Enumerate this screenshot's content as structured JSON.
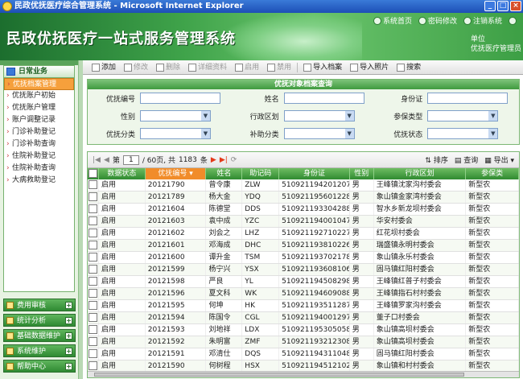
{
  "window": {
    "title": "民政优抚医疗综合管理系统 - Microsoft Internet Explorer"
  },
  "header": {
    "app_title": "民政优抚医疗一站式服务管理系统",
    "links": [
      {
        "label": "系统首页",
        "icon": "home-icon"
      },
      {
        "label": "密码修改",
        "icon": "key-icon"
      },
      {
        "label": "注销系统",
        "icon": "logout-icon"
      },
      {
        "label": "",
        "icon": "help-icon"
      }
    ],
    "user_line1": "单位",
    "user_line2": "优抚医疗管理员"
  },
  "sidebar": {
    "section_title": "日常业务",
    "items": [
      {
        "label": "优抚档案管理",
        "active": true
      },
      {
        "label": "优抚账户初始"
      },
      {
        "label": "优抚账户管理"
      },
      {
        "label": "账户调整记录"
      },
      {
        "label": "门诊补助登记"
      },
      {
        "label": "门诊补助查询"
      },
      {
        "label": "住院补助登记"
      },
      {
        "label": "住院补助查询"
      },
      {
        "label": "大病救助登记"
      }
    ],
    "groups": [
      {
        "label": "费用审核"
      },
      {
        "label": "统计分析"
      },
      {
        "label": "基础数据维护"
      },
      {
        "label": "系统维护"
      },
      {
        "label": "帮助中心"
      }
    ]
  },
  "toolbar": {
    "buttons": [
      {
        "label": "添加",
        "icon": "add-icon",
        "enabled": true
      },
      {
        "label": "修改",
        "icon": "edit-icon",
        "enabled": false
      },
      {
        "label": "删除",
        "icon": "delete-icon",
        "enabled": false
      },
      {
        "label": "详细资料",
        "icon": "details-icon",
        "enabled": false
      },
      {
        "label": "启用",
        "icon": "enable-icon",
        "enabled": false
      },
      {
        "label": "禁用",
        "icon": "disable-icon",
        "enabled": false
      },
      {
        "label": "导入档案",
        "icon": "import-icon",
        "enabled": true
      },
      {
        "label": "导入照片",
        "icon": "photo-icon",
        "enabled": true
      },
      {
        "label": "搜索",
        "icon": "search-icon",
        "enabled": true
      }
    ]
  },
  "search": {
    "caption": "优抚对象档案查询",
    "labels": {
      "code": "优抚编号",
      "name": "姓名",
      "idcard": "身份证",
      "gender": "性别",
      "region": "行政区划",
      "insurance": "参保类型",
      "category": "优抚分类",
      "subsidy": "补助分类",
      "status": "优抚状态"
    }
  },
  "pager": {
    "page_prefix": "第",
    "page": "1",
    "page_suffix": "/ 60页, 共",
    "total": "1183",
    "total_suffix": "条",
    "sort_label": "排序",
    "query_label": "查询",
    "export_label": "导出"
  },
  "table": {
    "columns": [
      "",
      "数据状态",
      "优抚编号",
      "姓名",
      "助记码",
      "身份证",
      "性别",
      "行政区划",
      "参保类"
    ],
    "rows": [
      [
        "启用",
        "20121790",
        "曾令康",
        "ZLW",
        "510921194201207817",
        "男",
        "王峰镇沈家沟村委会",
        "新型农"
      ],
      [
        "启用",
        "20121789",
        "杨大金",
        "YDQ",
        "51092119560122811x",
        "男",
        "象山镇金家湾村委会",
        "新型农"
      ],
      [
        "启用",
        "20121604",
        "陈德堂",
        "DDS",
        "510921193304288432",
        "男",
        "智水乡新龙坝村委会",
        "新型农"
      ],
      [
        "启用",
        "20121603",
        "袁中成",
        "YZC",
        "510921194001047716",
        "男",
        "华安村委会",
        "新型农"
      ],
      [
        "启用",
        "20121602",
        "刘会之",
        "LHZ",
        "510921192710227016",
        "男",
        "红花坝村委会",
        "新型农"
      ],
      [
        "启用",
        "20121601",
        "邓海成",
        "DHC",
        "510921193810226816",
        "男",
        "瑞盛镇永明村委会",
        "新型农"
      ],
      [
        "启用",
        "20121600",
        "谭升金",
        "TSM",
        "510921193702178036",
        "男",
        "象山镇永乐村委会",
        "新型农"
      ],
      [
        "启用",
        "20121599",
        "杨宁兴",
        "YSX",
        "510921193608106693",
        "男",
        "固马镇红阳村委会",
        "新型农"
      ],
      [
        "启用",
        "20121598",
        "严良",
        "YL",
        "510921194508298338",
        "男",
        "王峰镇红普子村委会",
        "新型农"
      ],
      [
        "启用",
        "20121596",
        "夏文科",
        "WK",
        "51092119460908833X",
        "男",
        "王峰镇指石村村委会",
        "新型农"
      ],
      [
        "启用",
        "20121595",
        "何坤",
        "HK",
        "510921193511287811",
        "男",
        "王峰镇罗家沟村委会",
        "新型农"
      ],
      [
        "启用",
        "20121594",
        "陈国令",
        "CGL",
        "510921194001297598",
        "男",
        "董子口村委会",
        "新型农"
      ],
      [
        "启用",
        "20121593",
        "刘地祥",
        "LDX",
        "510921195305058259",
        "男",
        "象山镇高坝村委会",
        "新型农"
      ],
      [
        "启用",
        "20121592",
        "朱明富",
        "ZMF",
        "510921193212308037",
        "男",
        "象山镇高坝村委会",
        "新型农"
      ],
      [
        "启用",
        "20121591",
        "邓清仕",
        "DQS",
        "510921194311048036",
        "男",
        "固马镇红阳村委会",
        "新型农"
      ],
      [
        "启用",
        "20121590",
        "何树程",
        "HSX",
        "51092119451210249X",
        "男",
        "象山镇和村村委会",
        "新型农"
      ]
    ]
  }
}
